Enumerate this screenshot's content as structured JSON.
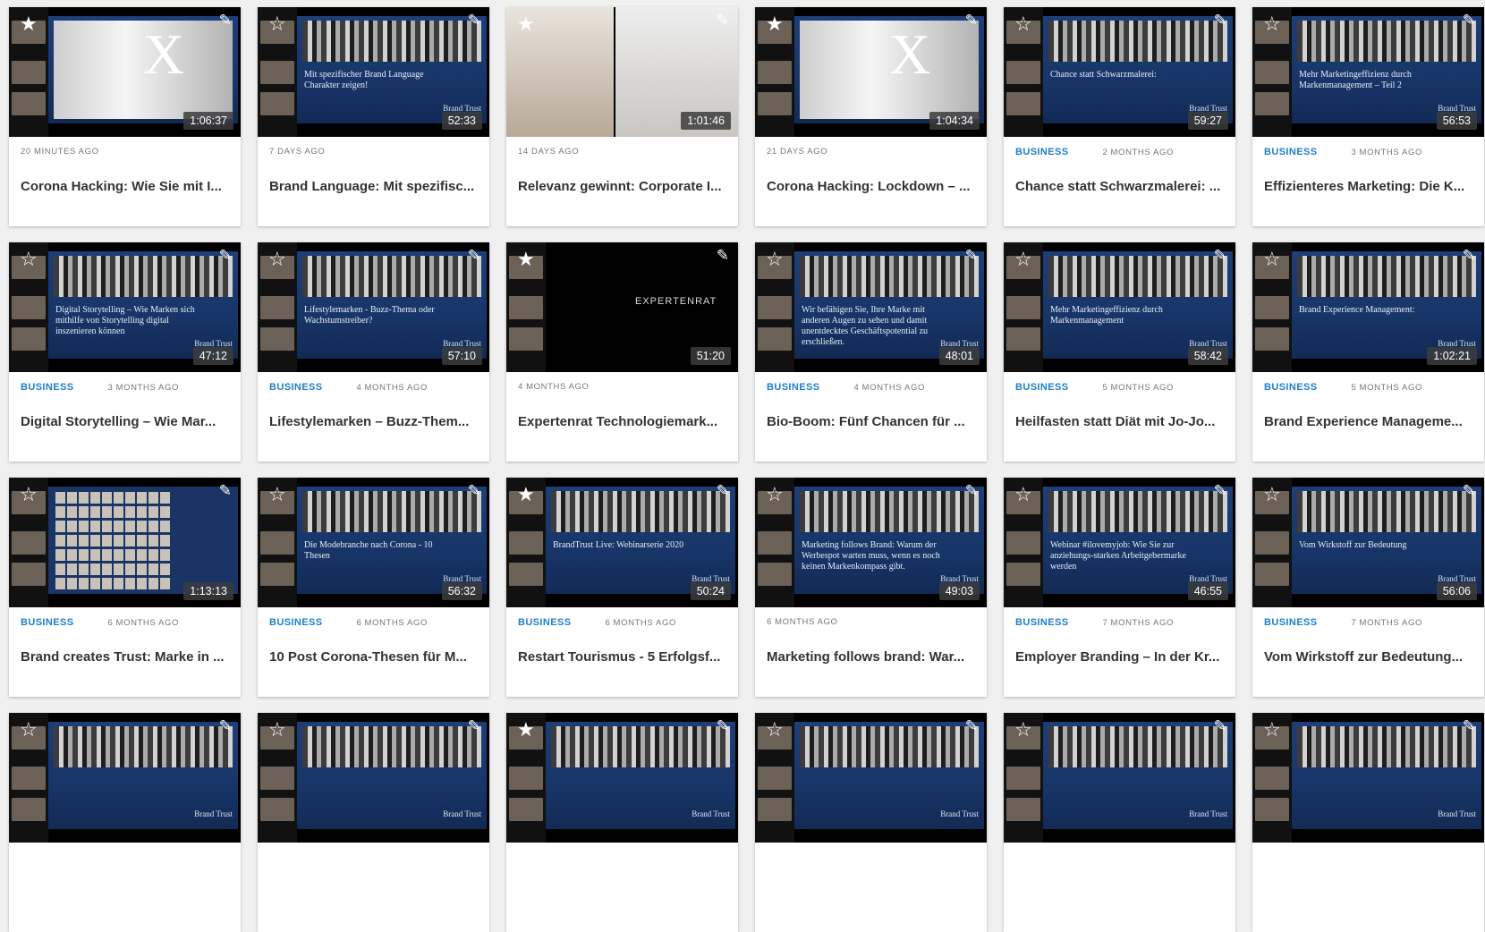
{
  "icons": {
    "star": "star-icon",
    "edit": "pencil-icon"
  },
  "colors": {
    "category": "#1f7fc9",
    "slide_bg": "#1d3e78",
    "page_bg": "#f0f0f0"
  },
  "rows": [
    [
      {
        "title": "Corona Hacking: Wie Sie mit I...",
        "category": "",
        "age": "20 MINUTES AGO",
        "duration": "1:06:37",
        "thumb": "x",
        "slide_text": "",
        "star_filled": true
      },
      {
        "title": "Brand Language: Mit spezifisc...",
        "category": "",
        "age": "7 DAYS AGO",
        "duration": "52:33",
        "thumb": "slide",
        "slide_text": "Mit spezifischer Brand Language Charakter zeigen!",
        "star_filled": false
      },
      {
        "title": "Relevanz gewinnt: Corporate I...",
        "category": "",
        "age": "14 DAYS AGO",
        "duration": "1:01:46",
        "thumb": "video",
        "slide_text": "",
        "star_filled": true
      },
      {
        "title": "Corona Hacking: Lockdown – ...",
        "category": "",
        "age": "21 DAYS AGO",
        "duration": "1:04:34",
        "thumb": "x",
        "slide_text": "",
        "star_filled": true
      },
      {
        "title": "Chance statt Schwarzmalerei: ...",
        "category": "BUSINESS",
        "age": "2 MONTHS AGO",
        "duration": "59:27",
        "thumb": "slide",
        "slide_text": "Chance statt Schwarzmalerei:",
        "star_filled": false
      },
      {
        "title": "Effizienteres Marketing: Die K...",
        "category": "BUSINESS",
        "age": "3 MONTHS AGO",
        "duration": "56:53",
        "thumb": "slide",
        "slide_text": "Mehr Marketingeffizienz durch Markenmanagement – Teil 2",
        "star_filled": false
      }
    ],
    [
      {
        "title": "Digital Storytelling – Wie Mar...",
        "category": "BUSINESS",
        "age": "3 MONTHS AGO",
        "duration": "47:12",
        "thumb": "slide",
        "slide_text": "Digital Storytelling – Wie Marken sich mithilfe von Storytelling digital inszenieren können",
        "star_filled": false
      },
      {
        "title": "Lifestylemarken – Buzz-Them...",
        "category": "BUSINESS",
        "age": "4 MONTHS AGO",
        "duration": "57:10",
        "thumb": "slide",
        "slide_text": "Lifestylemarken - Buzz-Thema oder Wachstumstreiber?",
        "star_filled": false
      },
      {
        "title": "Expertenrat Technologiemark...",
        "category": "",
        "age": "4 MONTHS AGO",
        "duration": "51:20",
        "thumb": "dark",
        "slide_text": "EXPERTENRAT",
        "star_filled": true
      },
      {
        "title": "Bio-Boom: Fünf Chancen für ...",
        "category": "BUSINESS",
        "age": "4 MONTHS AGO",
        "duration": "48:01",
        "thumb": "slide-photo",
        "slide_text": "Wir befähigen Sie, Ihre Marke mit anderen Augen zu sehen und damit unentdecktes Geschäftspotential zu erschließen.",
        "star_filled": false
      },
      {
        "title": "Heilfasten statt Diät mit Jo-Jo...",
        "category": "BUSINESS",
        "age": "5 MONTHS AGO",
        "duration": "58:42",
        "thumb": "slide",
        "slide_text": "Mehr Marketingeffizienz durch Markenmanagement",
        "star_filled": false
      },
      {
        "title": "Brand Experience Manageme...",
        "category": "BUSINESS",
        "age": "5 MONTHS AGO",
        "duration": "1:02:21",
        "thumb": "slide",
        "slide_text": "Brand Experience Management:",
        "star_filled": false
      }
    ],
    [
      {
        "title": "Brand creates Trust: Marke in ...",
        "category": "BUSINESS",
        "age": "6 MONTHS AGO",
        "duration": "1:13:13",
        "thumb": "gallery",
        "slide_text": "",
        "star_filled": false
      },
      {
        "title": "10 Post Corona-Thesen für M...",
        "category": "BUSINESS",
        "age": "6 MONTHS AGO",
        "duration": "56:32",
        "thumb": "slide",
        "slide_text": "Die Modebranche nach Corona - 10 Thesen",
        "star_filled": false
      },
      {
        "title": "Restart Tourismus - 5 Erfolgsf...",
        "category": "BUSINESS",
        "age": "6 MONTHS AGO",
        "duration": "50:24",
        "thumb": "slide-list",
        "slide_text": "BrandTrust Live: Webinarserie 2020",
        "star_filled": true
      },
      {
        "title": "Marketing follows brand: War...",
        "category": "",
        "age": "6 MONTHS AGO",
        "duration": "49:03",
        "thumb": "slide",
        "slide_text": "Marketing follows Brand: Warum der Werbespot warten muss, wenn es noch keinen Markenkompass gibt.",
        "star_filled": false
      },
      {
        "title": "Employer Branding – In der Kr...",
        "category": "BUSINESS",
        "age": "7 MONTHS AGO",
        "duration": "46:55",
        "thumb": "slide",
        "slide_text": "Webinar #ilovemyjob: Wie Sie zur anziehungs-starken Arbeitgebermarke werden",
        "star_filled": false
      },
      {
        "title": "Vom Wirkstoff zur Bedeutung...",
        "category": "BUSINESS",
        "age": "7 MONTHS AGO",
        "duration": "56:06",
        "thumb": "slide",
        "slide_text": "Vom Wirkstoff zur Bedeutung",
        "star_filled": false
      }
    ],
    [
      {
        "title": "",
        "category": "",
        "age": "",
        "duration": "",
        "thumb": "slide",
        "slide_text": "",
        "star_filled": false
      },
      {
        "title": "",
        "category": "",
        "age": "",
        "duration": "",
        "thumb": "slide",
        "slide_text": "",
        "star_filled": false
      },
      {
        "title": "",
        "category": "",
        "age": "",
        "duration": "",
        "thumb": "slide",
        "slide_text": "",
        "star_filled": true
      },
      {
        "title": "",
        "category": "",
        "age": "",
        "duration": "",
        "thumb": "slide",
        "slide_text": "",
        "star_filled": false
      },
      {
        "title": "",
        "category": "",
        "age": "",
        "duration": "",
        "thumb": "slide",
        "slide_text": "",
        "star_filled": false
      },
      {
        "title": "",
        "category": "",
        "age": "",
        "duration": "",
        "thumb": "slide",
        "slide_text": "",
        "star_filled": false
      }
    ]
  ],
  "brand_mark": "Brand Trust"
}
